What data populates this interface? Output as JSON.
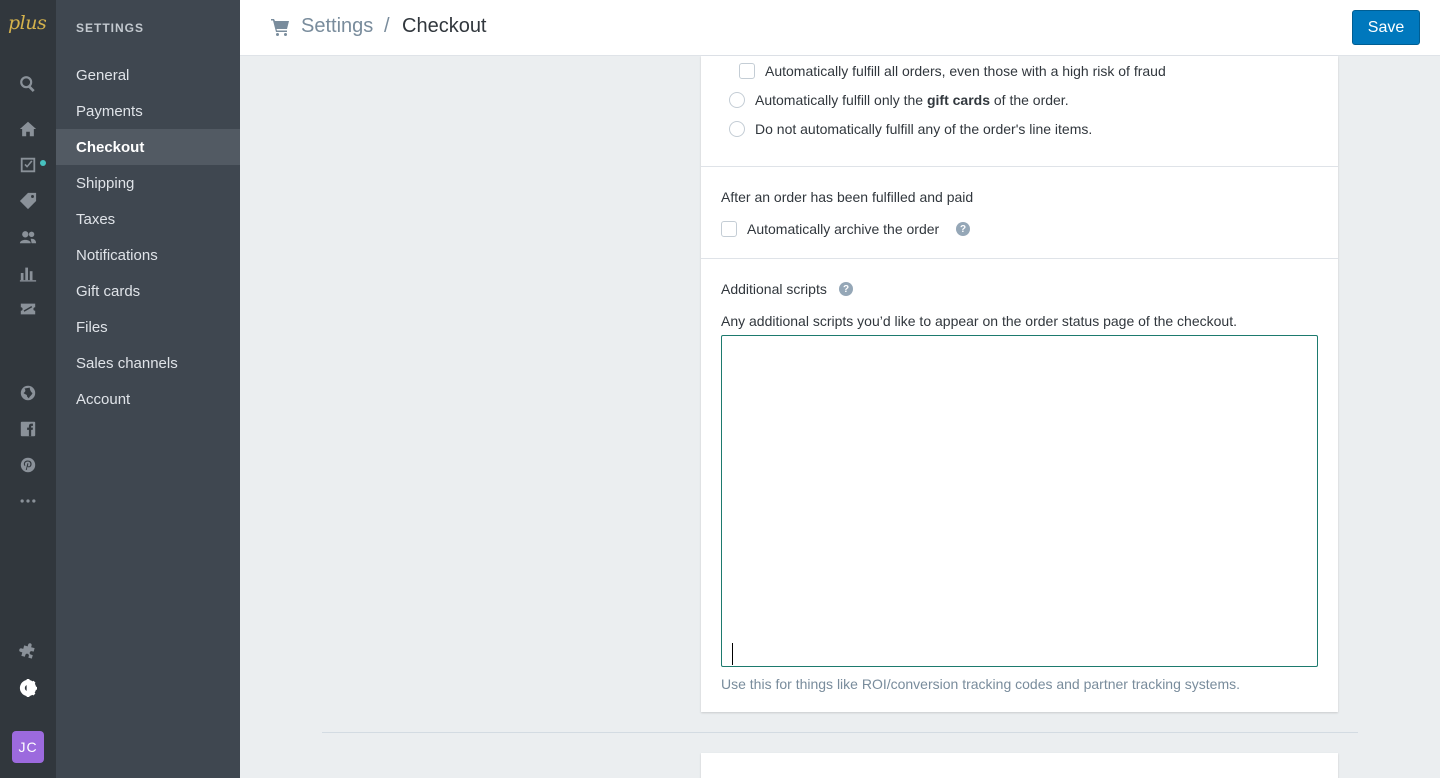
{
  "app": {
    "logo_text": "plus",
    "avatar_initials": "JC"
  },
  "rail": {
    "icons": [
      "search-icon",
      "home-icon",
      "orders-icon",
      "tag-icon",
      "customers-icon",
      "analytics-icon",
      "discounts-icon",
      "globe-icon",
      "facebook-icon",
      "pinterest-icon",
      "more-icon",
      "apps-icon",
      "settings-icon"
    ],
    "badge_color": "#47c1bf"
  },
  "nav": {
    "heading": "SETTINGS",
    "items": [
      {
        "label": "General"
      },
      {
        "label": "Payments"
      },
      {
        "label": "Checkout",
        "active": true
      },
      {
        "label": "Shipping"
      },
      {
        "label": "Taxes"
      },
      {
        "label": "Notifications"
      },
      {
        "label": "Gift cards"
      },
      {
        "label": "Files"
      },
      {
        "label": "Sales channels"
      },
      {
        "label": "Account"
      }
    ]
  },
  "header": {
    "breadcrumb_parent": "Settings",
    "breadcrumb_separator": "/",
    "title": "Checkout",
    "save_label": "Save"
  },
  "fulfillment": {
    "option_fraud_label": "Automatically fulfill all orders, even those with a high risk of fraud",
    "option_gift_prefix": "Automatically fulfill only the ",
    "option_gift_bold": "gift cards",
    "option_gift_suffix": " of the order.",
    "option_none_label": "Do not automatically fulfill any of the order's line items."
  },
  "archive": {
    "heading": "After an order has been fulfilled and paid",
    "checkbox_label": "Automatically archive the order",
    "help": "?"
  },
  "scripts": {
    "heading": "Additional scripts",
    "help": "?",
    "description": "Any additional scripts you’d like to appear on the order status page of the checkout.",
    "value": "",
    "hint": "Use this for things like ROI/conversion tracking codes and partner tracking systems."
  },
  "colors": {
    "primary": "#0078bd",
    "focus_border": "#1d7a6e",
    "avatar_bg": "#9c6ade",
    "logo": "#d4b24c"
  }
}
